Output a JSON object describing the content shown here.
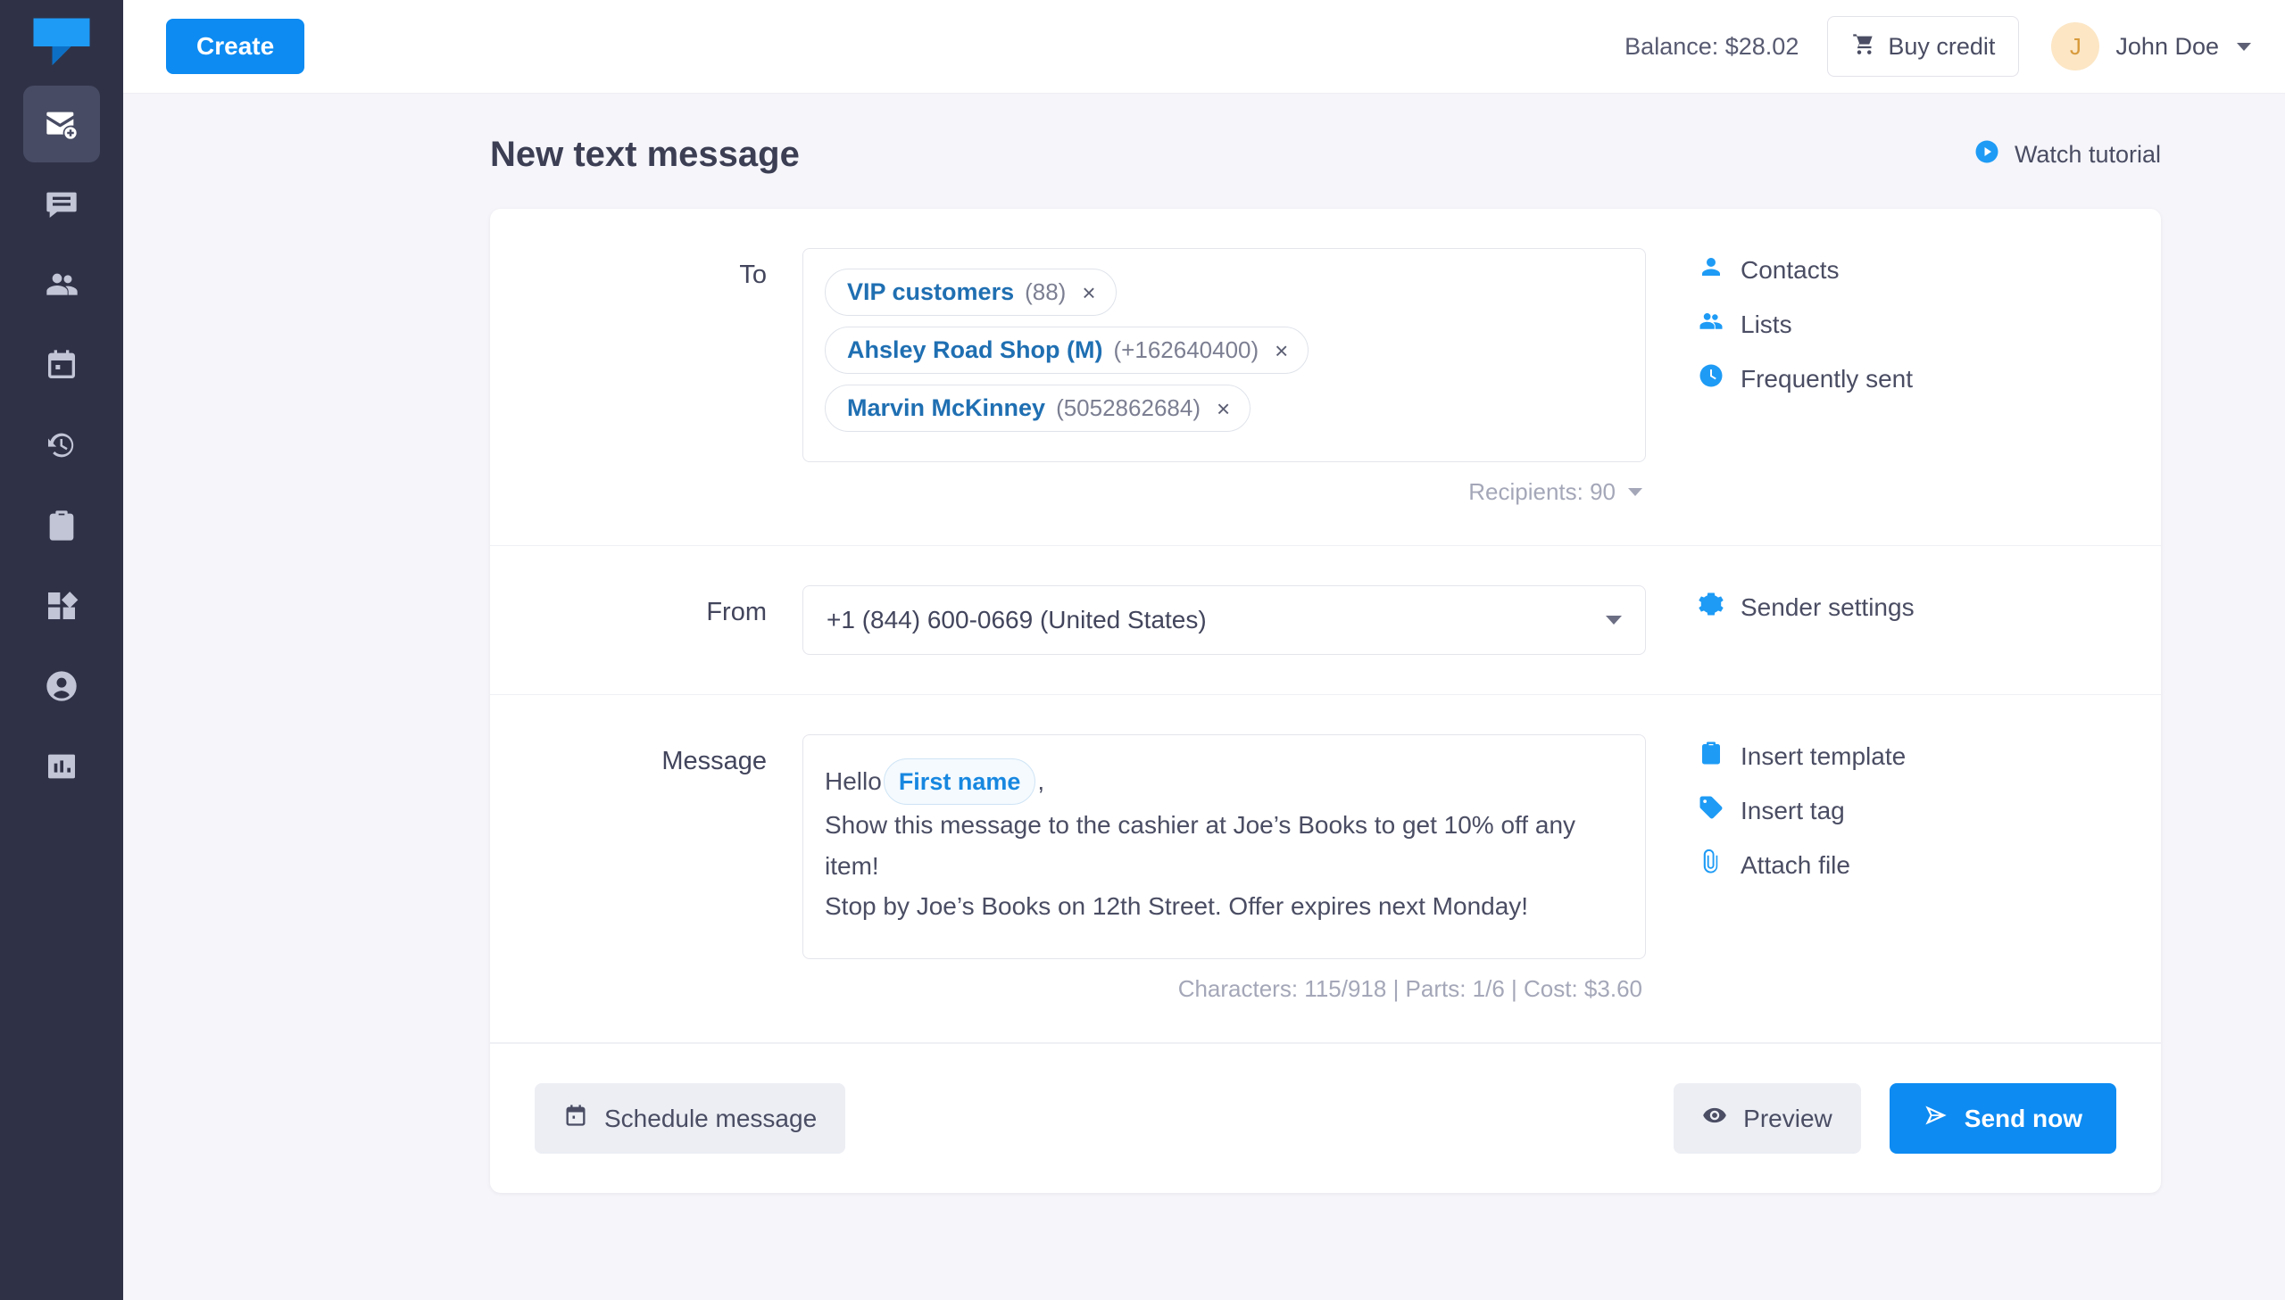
{
  "rail": {
    "logo_icon": "chat-logo-icon",
    "items": [
      {
        "icon": "new-message-icon",
        "active": true
      },
      {
        "icon": "conversations-icon",
        "active": false
      },
      {
        "icon": "contacts-icon",
        "active": false
      },
      {
        "icon": "calendar-icon",
        "active": false
      },
      {
        "icon": "history-icon",
        "active": false
      },
      {
        "icon": "templates-icon",
        "active": false
      },
      {
        "icon": "apps-icon",
        "active": false
      },
      {
        "icon": "account-icon",
        "active": false
      },
      {
        "icon": "reports-icon",
        "active": false
      }
    ]
  },
  "topbar": {
    "create_label": "Create",
    "balance_label": "Balance: $28.02",
    "buy_credit_label": "Buy credit",
    "user_initial": "J",
    "user_name": "John Doe"
  },
  "page": {
    "title": "New text message",
    "watch_tutorial_label": "Watch tutorial"
  },
  "to": {
    "label": "To",
    "chips": [
      {
        "name": "VIP customers",
        "meta": "(88)",
        "remove": "×"
      },
      {
        "name": "Ahsley Road Shop (M)",
        "meta": "(+162640400)",
        "remove": "×"
      },
      {
        "name": "Marvin McKinney",
        "meta": "(5052862684)",
        "remove": "×"
      }
    ],
    "recipients_label": "Recipients: 90",
    "aside": [
      {
        "label": "Contacts",
        "icon": "person-icon"
      },
      {
        "label": "Lists",
        "icon": "people-icon"
      },
      {
        "label": "Frequently sent",
        "icon": "clock-icon"
      }
    ]
  },
  "from": {
    "label": "From",
    "value": "+1 (844) 600-0669 (United States)",
    "aside": [
      {
        "label": "Sender settings",
        "icon": "gear-icon"
      }
    ]
  },
  "message": {
    "label": "Message",
    "line1_prefix": "Hello",
    "tag": "First name",
    "line1_suffix": ",",
    "line2": "Show this message to the cashier at Joe’s Books to get 10% off any item!",
    "line3": "Stop by Joe’s Books on 12th Street. Offer expires next Monday!",
    "counter": "Characters: 115/918  |  Parts: 1/6  |  Cost: $3.60",
    "aside": [
      {
        "label": "Insert template",
        "icon": "clipboard-icon"
      },
      {
        "label": "Insert tag",
        "icon": "tag-icon"
      },
      {
        "label": "Attach file",
        "icon": "paperclip-icon"
      }
    ]
  },
  "footer": {
    "schedule_label": "Schedule message",
    "preview_label": "Preview",
    "send_label": "Send now"
  },
  "colors": {
    "accent": "#0d8bf2",
    "rail": "#2f3247",
    "rail_active": "#474b63",
    "page_bg": "#f5f5fa",
    "chip_text": "#1f6fb2",
    "muted": "#a4a7b8"
  }
}
